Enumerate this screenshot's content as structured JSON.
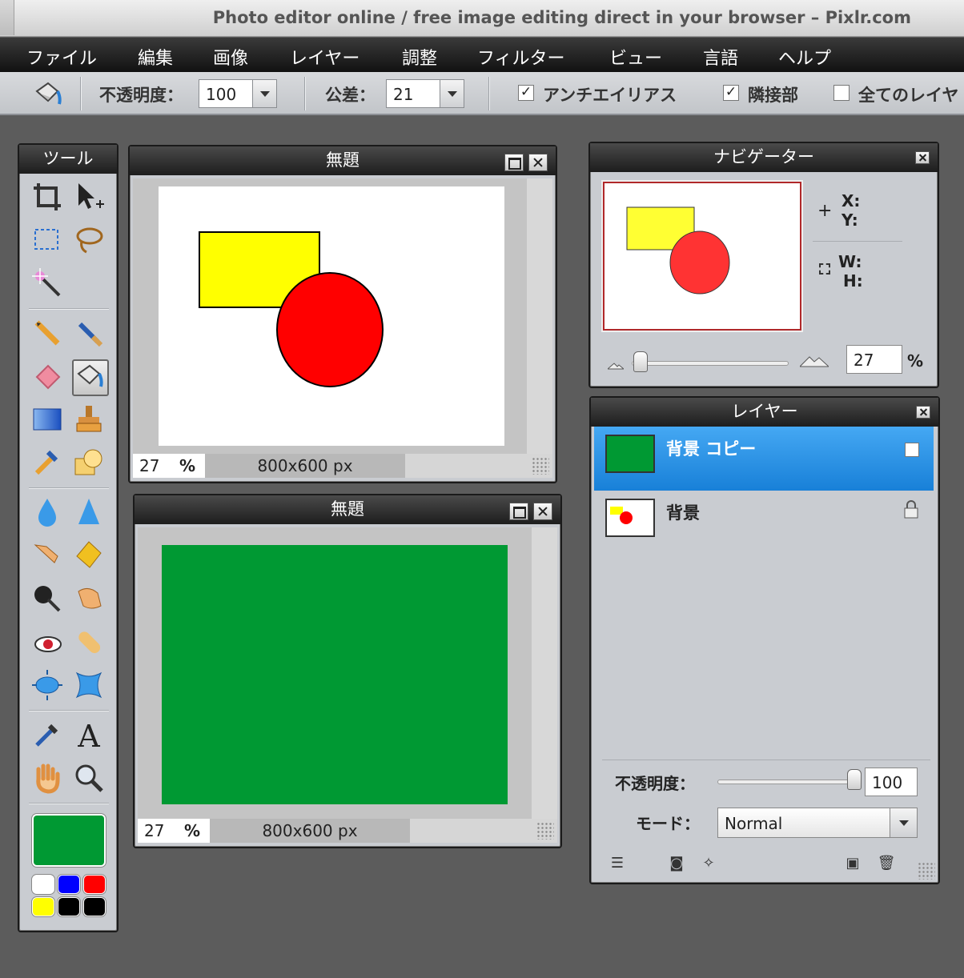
{
  "window": {
    "title": "Photo editor online / free image editing direct in your browser – Pixlr.com"
  },
  "menu": [
    "ファイル",
    "編集",
    "画像",
    "レイヤー",
    "調整",
    "フィルター",
    "ビュー",
    "言語",
    "ヘルプ"
  ],
  "options": {
    "opacity_label": "不透明度：",
    "opacity_value": "100",
    "tolerance_label": "公差：",
    "tolerance_value": "21",
    "antialias_label": "アンチエイリアス",
    "contiguous_label": "隣接部",
    "all_layers_label": "全てのレイヤ"
  },
  "tools_panel": {
    "title": "ツール",
    "foreground_color": "#009933",
    "swatches": [
      "#ffffff",
      "#0000ff",
      "#ff0000",
      "#ffff00",
      "#000000",
      "#000000"
    ]
  },
  "image_windows": [
    {
      "title": "無題",
      "zoom": "27",
      "zoom_unit": "%",
      "size": "800x600 px"
    },
    {
      "title": "無題",
      "zoom": "27",
      "zoom_unit": "%",
      "size": "800x600 px",
      "fill": "#009933"
    }
  ],
  "navigator": {
    "title": "ナビゲーター",
    "x_label": "X:",
    "y_label": "Y:",
    "w_label": "W:",
    "h_label": "H:",
    "zoom": "27",
    "zoom_unit": "%"
  },
  "layers": {
    "title": "レイヤー",
    "items": [
      {
        "name": "背景 コピー",
        "active": true
      },
      {
        "name": "背景",
        "locked": true
      }
    ],
    "opacity_label": "不透明度：",
    "opacity_value": "100",
    "mode_label": "モード：",
    "mode_value": "Normal"
  }
}
